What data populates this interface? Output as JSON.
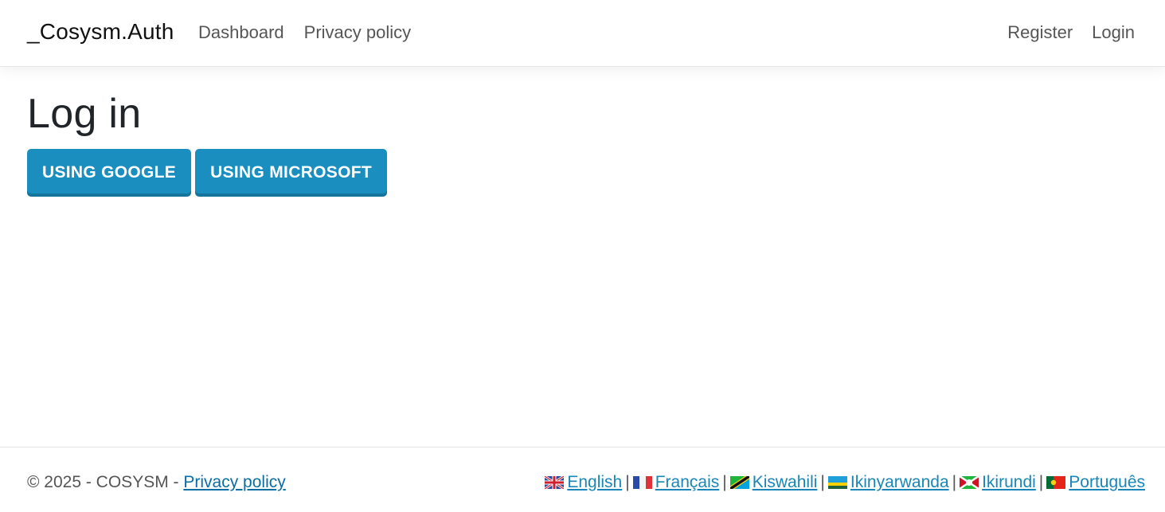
{
  "nav": {
    "brand": "_Cosysm.Auth",
    "left_links": [
      "Dashboard",
      "Privacy policy"
    ],
    "right_links": [
      "Register",
      "Login"
    ]
  },
  "main": {
    "title": "Log in",
    "buttons": [
      "USING GOOGLE",
      "USING MICROSOFT"
    ]
  },
  "footer": {
    "copyright": "© 2025 - COSYSM - ",
    "privacy_link": "Privacy policy",
    "separator": "|",
    "languages": [
      {
        "label": "English",
        "flag": "uk-flag-icon"
      },
      {
        "label": "Français",
        "flag": "france-flag-icon"
      },
      {
        "label": "Kiswahili",
        "flag": "tanzania-flag-icon"
      },
      {
        "label": "Ikinyarwanda",
        "flag": "rwanda-flag-icon"
      },
      {
        "label": "Ikirundi",
        "flag": "burundi-flag-icon"
      },
      {
        "label": "Português",
        "flag": "portugal-flag-icon"
      }
    ]
  },
  "colors": {
    "primary_button": "#1a8fbf",
    "link": "#1a86b8"
  }
}
